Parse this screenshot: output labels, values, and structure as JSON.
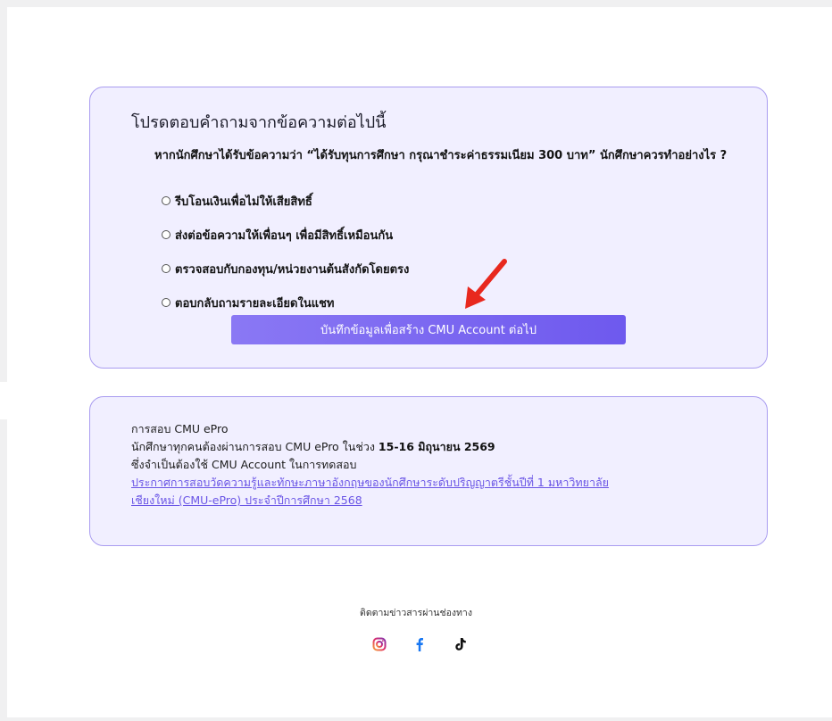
{
  "quiz": {
    "heading": "โปรดตอบคำถามจากข้อความต่อไปนี้",
    "question": "หากนักศึกษาได้รับข้อความว่า “ได้รับทุนการศึกษา กรุณาชำระค่าธรรมเนียม 300 บาท” นักศึกษาควรทำอย่างไร ?",
    "options": [
      "รีบโอนเงินเพื่อไม่ให้เสียสิทธิ์",
      "ส่งต่อข้อความให้เพื่อนๆ เพื่อมีสิทธิ์เหมือนกัน",
      "ตรวจสอบกับกองทุน/หน่วยงานต้นสังกัดโดยตรง",
      "ตอบกลับถามรายละเอียดในแชท"
    ],
    "submit_label": "บันทึกข้อมูลเพื่อสร้าง CMU Account ต่อไป"
  },
  "info": {
    "title": "การสอบ CMU ePro",
    "line2_prefix": "นักศึกษาทุกคนต้องผ่านการสอบ CMU ePro ในช่วง ",
    "line2_dates": "15-16 มิถุนายน 2569",
    "line3": "ซึ่งจำเป็นต้องใช้ CMU Account ในการทดสอบ",
    "link_line1": "ประกาศการสอบวัดความรู้และทักษะภาษาอังกฤษของนักศึกษาระดับปริญญาตรีชั้นปีที่ 1 มหาวิทยาลัย",
    "link_line2": "เชียงใหม่ (CMU-ePro) ประจำปีการศึกษา 2568"
  },
  "footer": {
    "follow_text": "ติดตามข่าวสารผ่านช่องทาง",
    "social_icons": [
      "instagram-icon",
      "facebook-icon",
      "tiktok-icon"
    ]
  },
  "colors": {
    "accent": "#7b66f0",
    "card_background": "#f1efff",
    "card_border": "#a99cf0",
    "annotation_arrow": "#e8281e"
  }
}
